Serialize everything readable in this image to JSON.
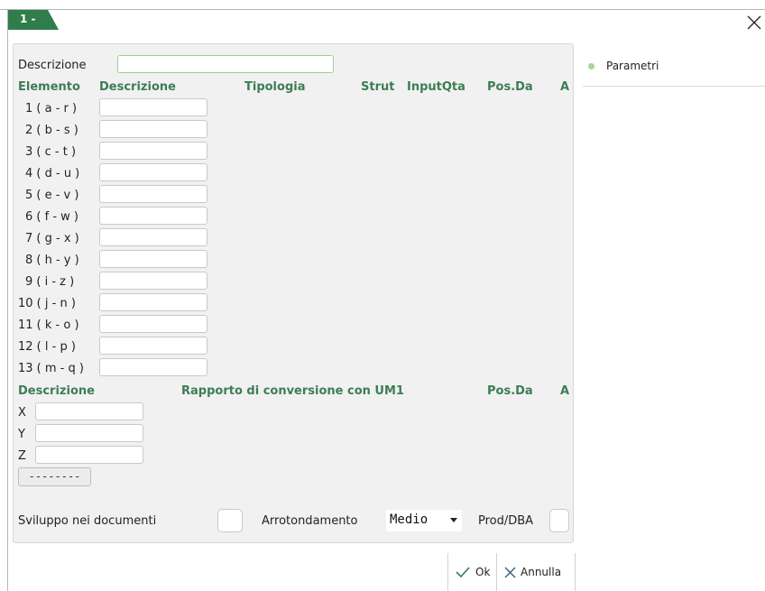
{
  "window": {
    "tab_label": "1 -"
  },
  "form": {
    "descrizione_label": "Descrizione",
    "descrizione_value": "",
    "elements_header": {
      "elemento": "Elemento",
      "descrizione": "Descrizione",
      "tipologia": "Tipologia",
      "strut": "Strut",
      "inputqta": "InputQta",
      "posda": "Pos.Da",
      "a": "A"
    },
    "elements": [
      {
        "label": "1  ( a - r )",
        "value": ""
      },
      {
        "label": "2  ( b - s )",
        "value": ""
      },
      {
        "label": "3  ( c - t )",
        "value": ""
      },
      {
        "label": "4  ( d - u )",
        "value": ""
      },
      {
        "label": "5  ( e - v )",
        "value": ""
      },
      {
        "label": "6  ( f - w )",
        "value": ""
      },
      {
        "label": "7  ( g - x )",
        "value": ""
      },
      {
        "label": "8  ( h - y )",
        "value": ""
      },
      {
        "label": "9  ( i - z )",
        "value": ""
      },
      {
        "label": "10  ( j - n )",
        "value": ""
      },
      {
        "label": "11  ( k - o )",
        "value": ""
      },
      {
        "label": "12  ( l - p )",
        "value": ""
      },
      {
        "label": "13  ( m - q )",
        "value": ""
      }
    ],
    "conversion_header": {
      "descrizione": "Descrizione",
      "rapporto": "Rapporto di conversione con UM1",
      "posda": "Pos.Da",
      "a": "A"
    },
    "conversions": [
      {
        "label": "X",
        "value": ""
      },
      {
        "label": "Y",
        "value": ""
      },
      {
        "label": "Z",
        "value": ""
      }
    ],
    "dash_button_label": "--------",
    "sviluppo_label": "Sviluppo nei documenti",
    "arrotondamento_label": "Arrotondamento",
    "arrotondamento_value": "Medio",
    "prod_dba_label": "Prod/DBA"
  },
  "sidebar": {
    "items": [
      {
        "label": "Parametri"
      }
    ]
  },
  "footer": {
    "ok_label": "Ok",
    "annulla_label": "Annulla"
  },
  "colors": {
    "header_green": "#3d7d55",
    "tab_green": "#2f7d4a",
    "accent_light_green": "#9fd089"
  }
}
